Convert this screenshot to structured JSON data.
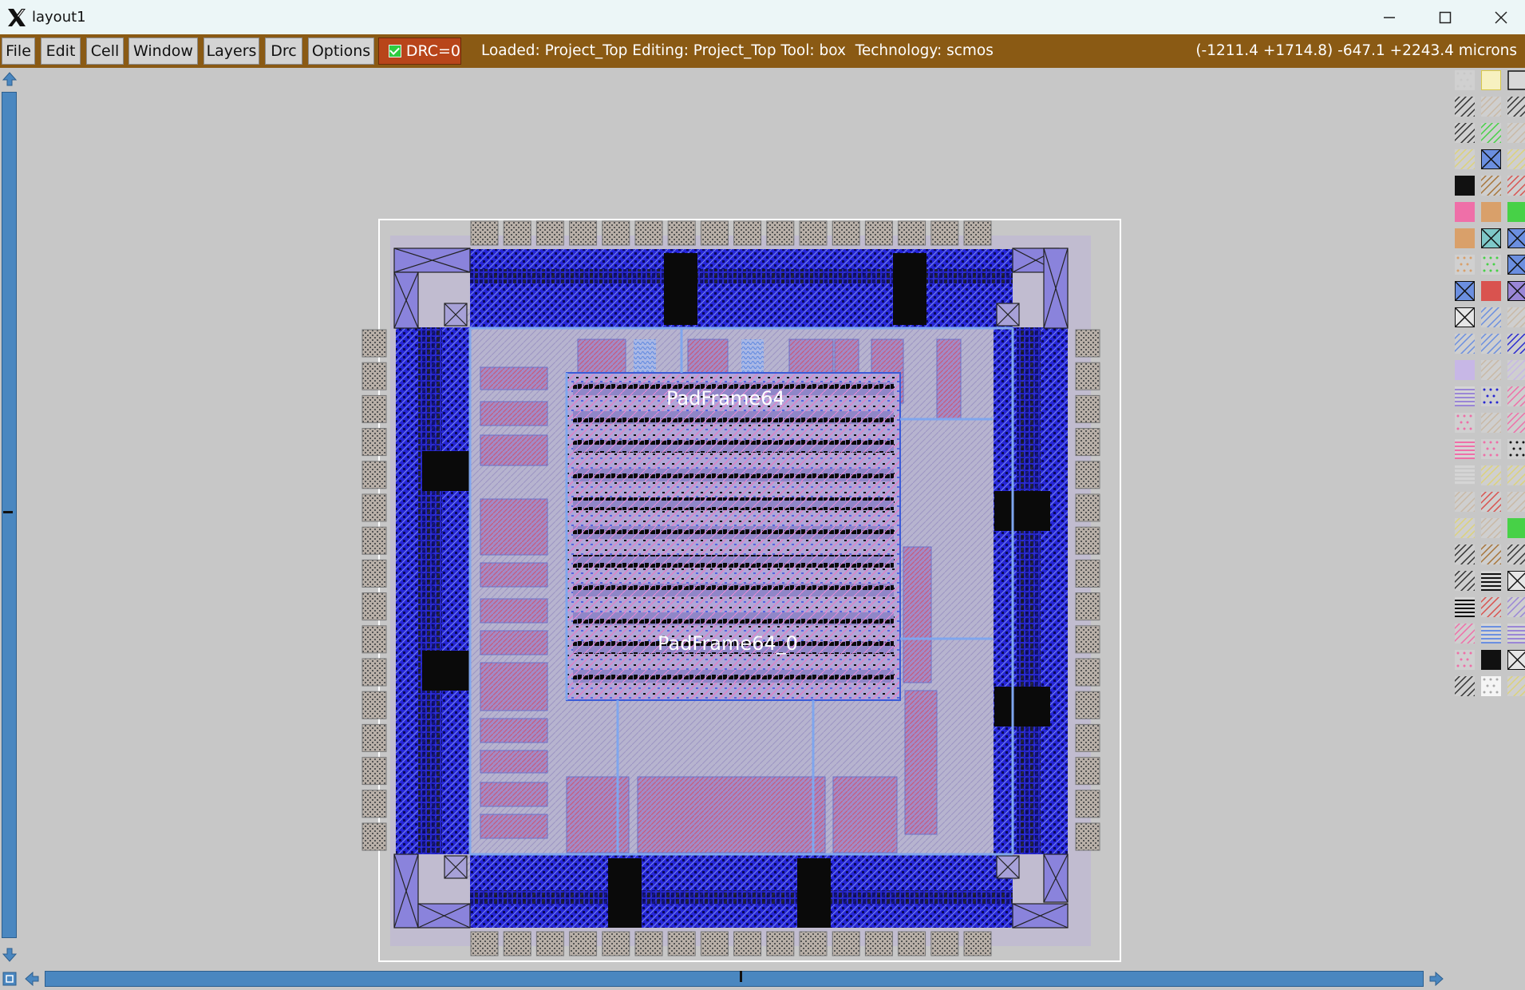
{
  "window": {
    "title": "layout1",
    "controls": [
      "minimize-icon",
      "maximize-icon",
      "close-icon"
    ]
  },
  "menu": {
    "items": [
      "File",
      "Edit",
      "Cell",
      "Window",
      "Layers",
      "Drc",
      "Options"
    ],
    "drc_label": "DRC=0"
  },
  "status": {
    "text": "Loaded: Project_Top Editing: Project_Top Tool: box  Technology: scmos",
    "coords": "(-1211.4 +1714.8) -647.1 +2243.4 microns"
  },
  "layout": {
    "labels": [
      "PadFrame64",
      "PadFrame64_0"
    ]
  },
  "colors": {
    "menubar": "#8a5a14",
    "drc": "#b8451a",
    "scrollbar": "#4a87c0",
    "canvas": "#c7c7c7"
  },
  "palette": {
    "rows": [
      [
        "dots-gray",
        "yellow-outline",
        "outline-black"
      ],
      [
        "hatch-black",
        "hatch-tan",
        "hatch-black"
      ],
      [
        "hatch-black",
        "hatch-green",
        "hatch-tan"
      ],
      [
        "hatch-yellow",
        "x-blue",
        "hatch-yellow"
      ],
      [
        "solid-black",
        "hatch-brown",
        "hatch-red"
      ],
      [
        "solid-pink",
        "solid-orange",
        "solid-green"
      ],
      [
        "solid-orange",
        "x-teal",
        "x-blue"
      ],
      [
        "dots-orange",
        "dots-green",
        "x-blue"
      ],
      [
        "x-blue",
        "solid-red",
        "x-purple"
      ],
      [
        "x-black",
        "hatch-blue",
        "hatch-tan"
      ],
      [
        "hatch-blue",
        "hatch-blue",
        "hatch-navy"
      ],
      [
        "solid-lavender",
        "hatch-tan",
        "hatch-lavender"
      ],
      [
        "lines-purple",
        "dots-navy",
        "hatch-pink"
      ],
      [
        "dots-pink",
        "hatch-tan",
        "hatch-pink"
      ],
      [
        "lines-pink",
        "dots-pink",
        "dots-black"
      ],
      [
        "lines-gray",
        "hatch-yellow",
        "hatch-yellow"
      ],
      [
        "hatch-tan",
        "hatch-red",
        "hatch-tan"
      ],
      [
        "hatch-yellow",
        "hatch-tan",
        "solid-green"
      ],
      [
        "hatch-black",
        "hatch-brown",
        "hatch-black"
      ],
      [
        "hatch-black",
        "lines-black",
        "x-black"
      ],
      [
        "lines-black",
        "hatch-red",
        "hatch-purple"
      ],
      [
        "hatch-pink",
        "lines-blue",
        "lines-purple"
      ],
      [
        "dots-pink",
        "solid-black",
        "x-black"
      ],
      [
        "hatch-black",
        "dots-white",
        "hatch-yellow"
      ]
    ]
  }
}
